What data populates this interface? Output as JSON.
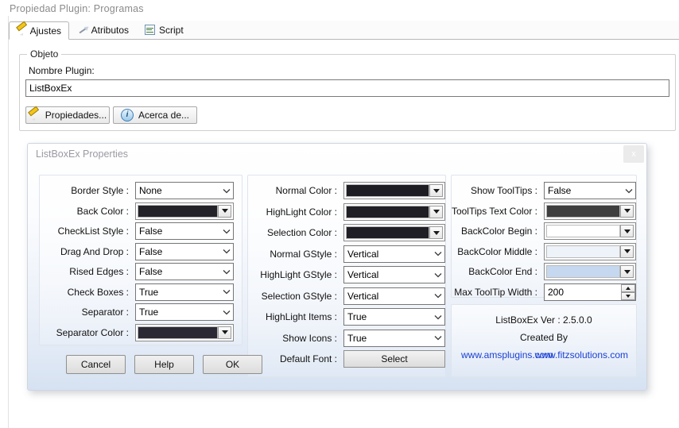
{
  "host": {
    "title": "Propiedad Plugin:  Programas",
    "tabs": [
      {
        "label": "Ajustes",
        "icon": "pencil-icon",
        "active": true
      },
      {
        "label": "Atributos",
        "icon": "dart-icon",
        "active": false
      },
      {
        "label": "Script",
        "icon": "script-icon",
        "active": false
      }
    ],
    "group": {
      "legend": "Objeto",
      "field_label": "Nombre Plugin:",
      "field_value": "ListBoxEx",
      "field_placeholder": "",
      "buttons": [
        {
          "label": "Propiedades...",
          "icon": "pencil-icon"
        },
        {
          "label": "Acerca de...",
          "icon": "info-icon"
        }
      ]
    }
  },
  "dialog": {
    "title": "ListBoxEx Properties",
    "close_label": "x",
    "left_panel": [
      {
        "label": "Border Style :",
        "type": "combo",
        "value": "None"
      },
      {
        "label": "Back Color :",
        "type": "color",
        "value": "#242229"
      },
      {
        "label": "CheckList Style :",
        "type": "combo",
        "value": "False"
      },
      {
        "label": "Drag And Drop :",
        "type": "combo",
        "value": "False"
      },
      {
        "label": "Rised Edges :",
        "type": "combo",
        "value": "False"
      },
      {
        "label": "Check Boxes :",
        "type": "combo",
        "value": "True"
      },
      {
        "label": "Separator :",
        "type": "combo",
        "value": "True"
      },
      {
        "label": "Separator Color :",
        "type": "color",
        "value": "#2b2933"
      }
    ],
    "mid_panel": [
      {
        "label": "Normal Color :",
        "type": "color",
        "value": "#1f1d24"
      },
      {
        "label": "HighLight Color :",
        "type": "color",
        "value": "#211f26"
      },
      {
        "label": "Selection Color :",
        "type": "color",
        "value": "#211f26"
      },
      {
        "label": "Normal GStyle :",
        "type": "combo",
        "value": "Vertical"
      },
      {
        "label": "HighLight GStyle :",
        "type": "combo",
        "value": "Vertical"
      },
      {
        "label": "Selection GStyle :",
        "type": "combo",
        "value": "Vertical"
      },
      {
        "label": "HighLight Items :",
        "type": "combo",
        "value": "True"
      },
      {
        "label": "Show Icons :",
        "type": "combo",
        "value": "True"
      },
      {
        "label": "Default Font :",
        "type": "button",
        "value": "Select"
      }
    ],
    "right_panel": [
      {
        "label": "Show ToolTips :",
        "type": "combo",
        "value": "False"
      },
      {
        "label": "ToolTips Text Color :",
        "type": "color",
        "value": "#3f3f3f"
      },
      {
        "label": "BackColor Begin :",
        "type": "color",
        "value": "#ffffff"
      },
      {
        "label": "BackColor Middle :",
        "type": "color",
        "value": "#eef3f9"
      },
      {
        "label": "BackColor End :",
        "type": "color",
        "value": "#c5d8ef"
      },
      {
        "label": "Max ToolTip Width :",
        "type": "spinner",
        "value": "200"
      }
    ],
    "about": {
      "version": "ListBoxEx Ver : 2.5.0.0",
      "created_by": "Created By",
      "link1": "www.amsplugins.com",
      "link2": "www.fitzsolutions.com",
      "link_color": "#1a3fd4"
    },
    "footer_buttons": [
      {
        "label": "Cancel"
      },
      {
        "label": "Help"
      },
      {
        "label": "OK"
      }
    ]
  }
}
